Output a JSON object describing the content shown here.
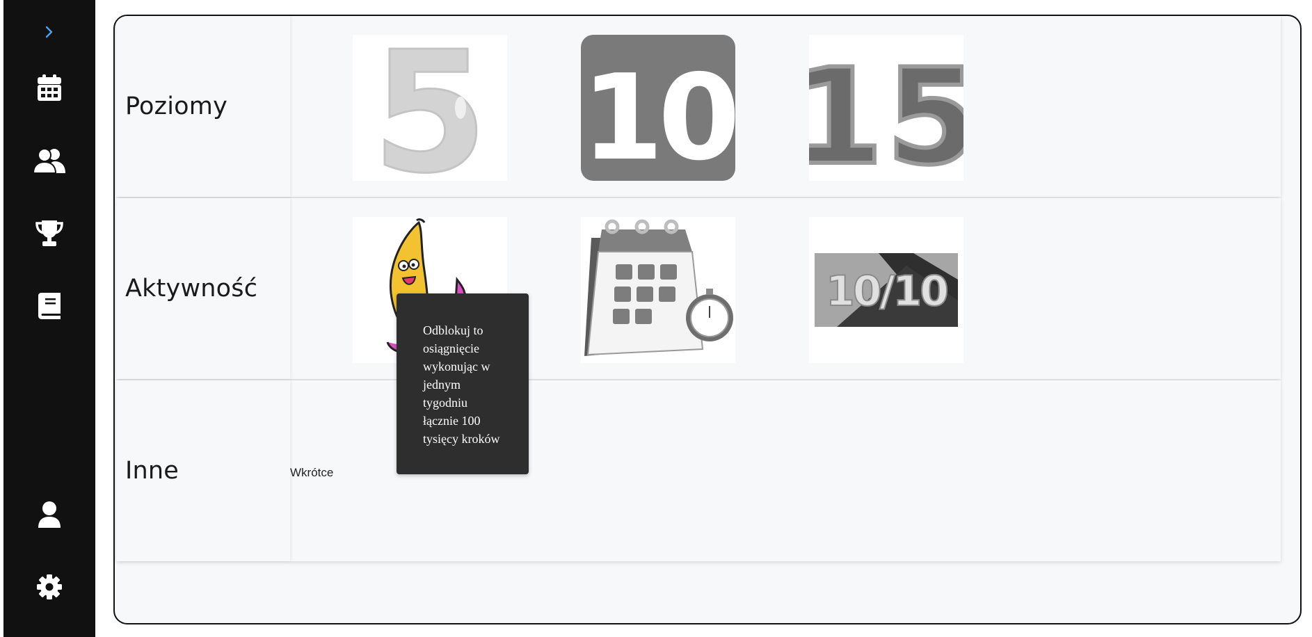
{
  "sidebar": {
    "items": [
      {
        "icon": "chevron-right-icon"
      },
      {
        "icon": "calendar-icon"
      },
      {
        "icon": "users-icon"
      },
      {
        "icon": "trophy-icon"
      },
      {
        "icon": "book-icon"
      },
      {
        "icon": "user-icon"
      },
      {
        "icon": "gear-icon"
      }
    ],
    "accent": "#4aa3f0",
    "background": "#111111"
  },
  "sections": [
    {
      "label": "Poziomy",
      "badges": [
        {
          "icon": "level-5-badge-icon",
          "text": "5"
        },
        {
          "icon": "level-10-badge-icon",
          "text": "10"
        },
        {
          "icon": "level-15-badge-icon",
          "text": "15"
        }
      ]
    },
    {
      "label": "Aktywność",
      "badges": [
        {
          "icon": "banana-badge-icon"
        },
        {
          "icon": "calendar-stopwatch-badge-icon"
        },
        {
          "icon": "ten-of-ten-badge-icon",
          "text": "10/10"
        }
      ]
    },
    {
      "label": "Inne",
      "empty_text": "Wkrótce"
    }
  ],
  "tooltip": {
    "lines": [
      "Odblokuj to",
      "osiągnięcie",
      "wykonując w",
      "jednym",
      "tygodniu",
      "łącznie 100",
      "tysięcy kroków"
    ]
  }
}
